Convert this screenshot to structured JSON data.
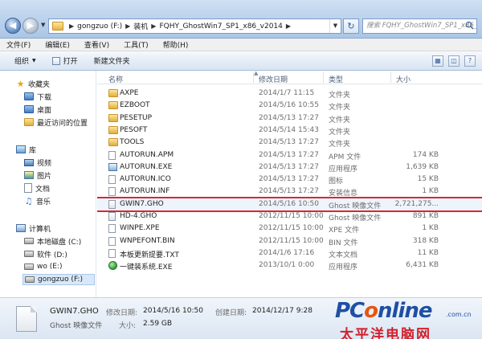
{
  "address": {
    "breadcrumbs": [
      "gongzuo (F:)",
      "装机",
      "FQHY_GhostWin7_SP1_x86_v2014"
    ],
    "search_placeholder": "搜索 FQHY_GhostWin7_SP1_x86_v2..."
  },
  "menu": [
    "文件(F)",
    "编辑(E)",
    "查看(V)",
    "工具(T)",
    "帮助(H)"
  ],
  "toolbar": {
    "organize": "组织",
    "open": "打开",
    "new_folder": "新建文件夹"
  },
  "nav": {
    "favorites": "收藏夹",
    "fav_items": [
      "下载",
      "桌面",
      "最近访问的位置"
    ],
    "libraries": "库",
    "lib_items": [
      "视频",
      "图片",
      "文档",
      "音乐"
    ],
    "computer": "计算机",
    "drives": [
      "本地磁盘 (C:)",
      "软件 (D:)",
      "wo (E:)",
      "gongzuo (F:)"
    ]
  },
  "columns": {
    "name": "名称",
    "date": "修改日期",
    "type": "类型",
    "size": "大小"
  },
  "files": [
    {
      "name": "AXPE",
      "date": "2014/1/7 11:15",
      "type": "文件夹",
      "size": "",
      "icon": "folder"
    },
    {
      "name": "EZBOOT",
      "date": "2014/5/16 10:55",
      "type": "文件夹",
      "size": "",
      "icon": "folder"
    },
    {
      "name": "PESETUP",
      "date": "2014/5/13 17:27",
      "type": "文件夹",
      "size": "",
      "icon": "folder"
    },
    {
      "name": "PESOFT",
      "date": "2014/5/14 15:43",
      "type": "文件夹",
      "size": "",
      "icon": "folder"
    },
    {
      "name": "TOOLS",
      "date": "2014/5/13 17:27",
      "type": "文件夹",
      "size": "",
      "icon": "folder"
    },
    {
      "name": "AUTORUN.APM",
      "date": "2014/5/13 17:27",
      "type": "APM 文件",
      "size": "174 KB",
      "icon": "file"
    },
    {
      "name": "AUTORUN.EXE",
      "date": "2014/5/13 17:27",
      "type": "应用程序",
      "size": "1,639 KB",
      "icon": "app"
    },
    {
      "name": "AUTORUN.ICO",
      "date": "2014/5/13 17:27",
      "type": "图标",
      "size": "15 KB",
      "icon": "file"
    },
    {
      "name": "AUTORUN.INF",
      "date": "2014/5/13 17:27",
      "type": "安装信息",
      "size": "1 KB",
      "icon": "file"
    },
    {
      "name": "GWIN7.GHO",
      "date": "2014/5/16 10:50",
      "type": "Ghost 映像文件",
      "size": "2,721,275...",
      "icon": "ghost"
    },
    {
      "name": "HD-4.GHO",
      "date": "2012/11/15 10:00",
      "type": "Ghost 映像文件",
      "size": "891 KB",
      "icon": "ghost"
    },
    {
      "name": "WINPE.XPE",
      "date": "2012/11/15 10:00",
      "type": "XPE 文件",
      "size": "1 KB",
      "icon": "file"
    },
    {
      "name": "WNPEFONT.BIN",
      "date": "2012/11/15 10:00",
      "type": "BIN 文件",
      "size": "318 KB",
      "icon": "file"
    },
    {
      "name": "本板更新提要.TXT",
      "date": "2014/1/6 17:16",
      "type": "文本文档",
      "size": "11 KB",
      "icon": "file"
    },
    {
      "name": "一键装系统.EXE",
      "date": "2013/10/1 0:00",
      "type": "应用程序",
      "size": "6,431 KB",
      "icon": "globe"
    }
  ],
  "details": {
    "name": "GWIN7.GHO",
    "type": "Ghost 映像文件",
    "modified_label": "修改日期:",
    "modified": "2014/5/16 10:50",
    "created_label": "创建日期:",
    "created": "2014/12/17 9:28",
    "size_label": "大小:",
    "size": "2.59 GB"
  },
  "watermark": {
    "brand_a": "PC",
    "brand_o": "o",
    "brand_b": "nline",
    "domain": ".com.cn",
    "cn": "太平洋电脑网"
  }
}
